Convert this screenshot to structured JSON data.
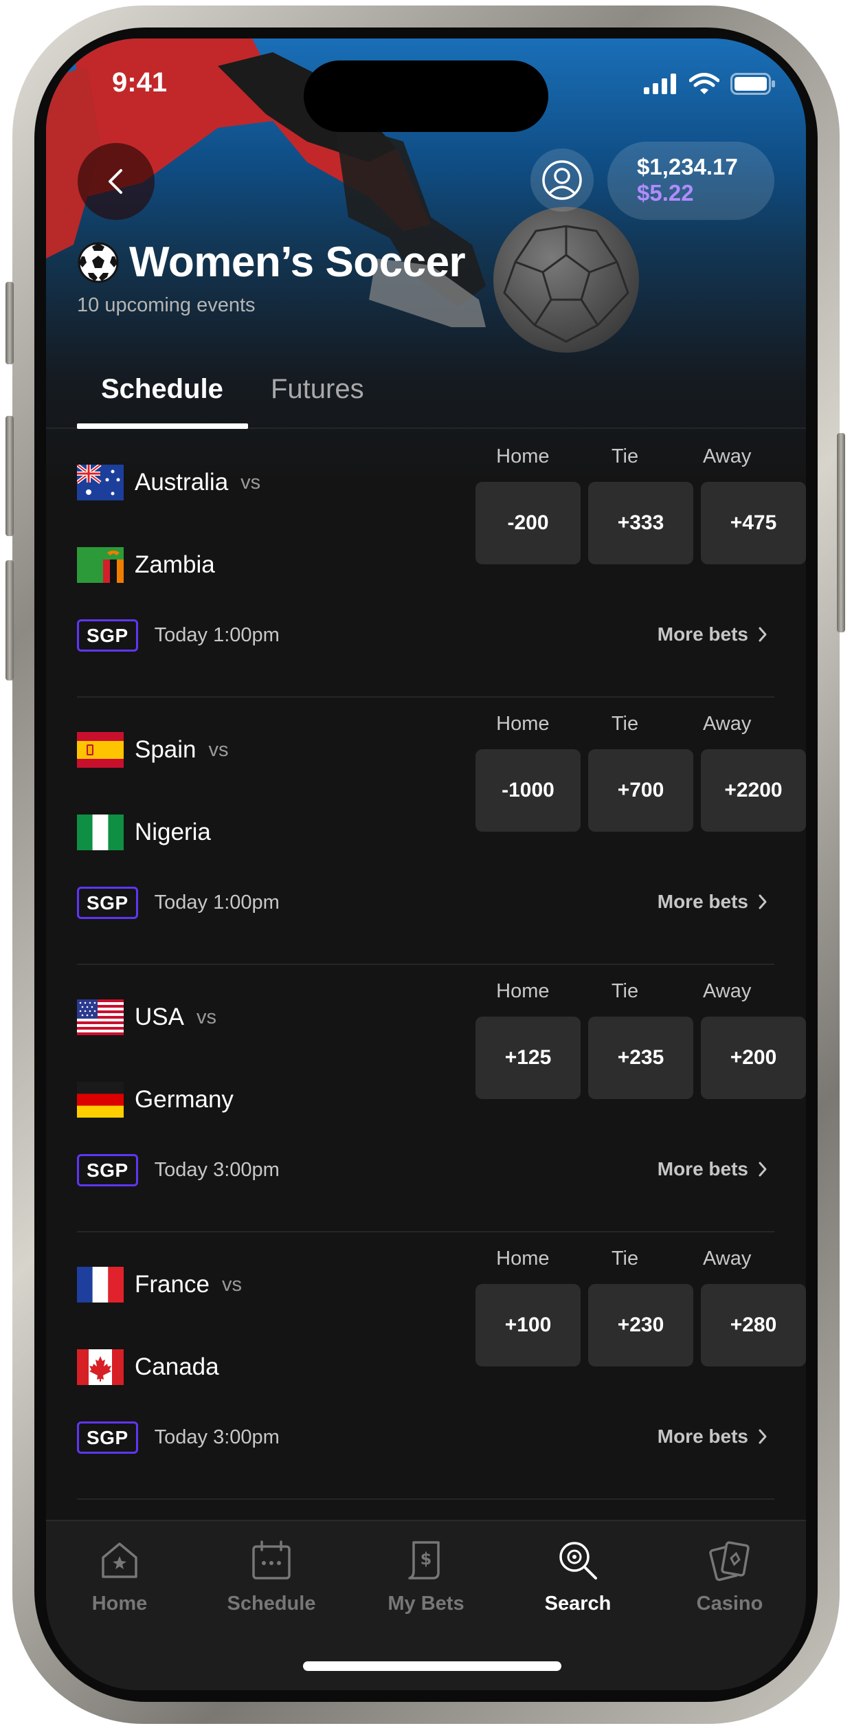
{
  "status_bar": {
    "time": "9:41"
  },
  "header": {
    "balance": "$1,234.17",
    "bonus_balance": "$5.22",
    "title": "Women’s Soccer",
    "subtitle": "10 upcoming events"
  },
  "tabs": [
    {
      "label": "Schedule",
      "active": true
    },
    {
      "label": "Futures",
      "active": false
    }
  ],
  "odds_headers": [
    "Home",
    "Tie",
    "Away"
  ],
  "events": [
    {
      "home": "Australia",
      "away": "Zambia",
      "vs": "vs",
      "odds": [
        "-200",
        "+333",
        "+475"
      ],
      "badge": "SGP",
      "kickoff": "Today 1:00pm",
      "more": "More bets"
    },
    {
      "home": "Spain",
      "away": "Nigeria",
      "vs": "vs",
      "odds": [
        "-1000",
        "+700",
        "+2200"
      ],
      "badge": "SGP",
      "kickoff": "Today 1:00pm",
      "more": "More bets"
    },
    {
      "home": "USA",
      "away": "Germany",
      "vs": "vs",
      "odds": [
        "+125",
        "+235",
        "+200"
      ],
      "badge": "SGP",
      "kickoff": "Today 3:00pm",
      "more": "More bets"
    },
    {
      "home": "France",
      "away": "Canada",
      "vs": "vs",
      "odds": [
        "+100",
        "+230",
        "+280"
      ],
      "badge": "SGP",
      "kickoff": "Today 3:00pm",
      "more": "More bets"
    }
  ],
  "bottom_nav": [
    {
      "label": "Home",
      "icon": "home-icon",
      "active": false
    },
    {
      "label": "Schedule",
      "icon": "calendar-icon",
      "active": false
    },
    {
      "label": "My Bets",
      "icon": "bet-slip-icon",
      "active": false
    },
    {
      "label": "Search",
      "icon": "search-icon",
      "active": true
    },
    {
      "label": "Casino",
      "icon": "cards-icon",
      "active": false
    }
  ],
  "colors": {
    "accent": "#5f36f5",
    "bonus": "#b08cff",
    "background": "#141414",
    "odds_button": "#2d2d2d"
  }
}
